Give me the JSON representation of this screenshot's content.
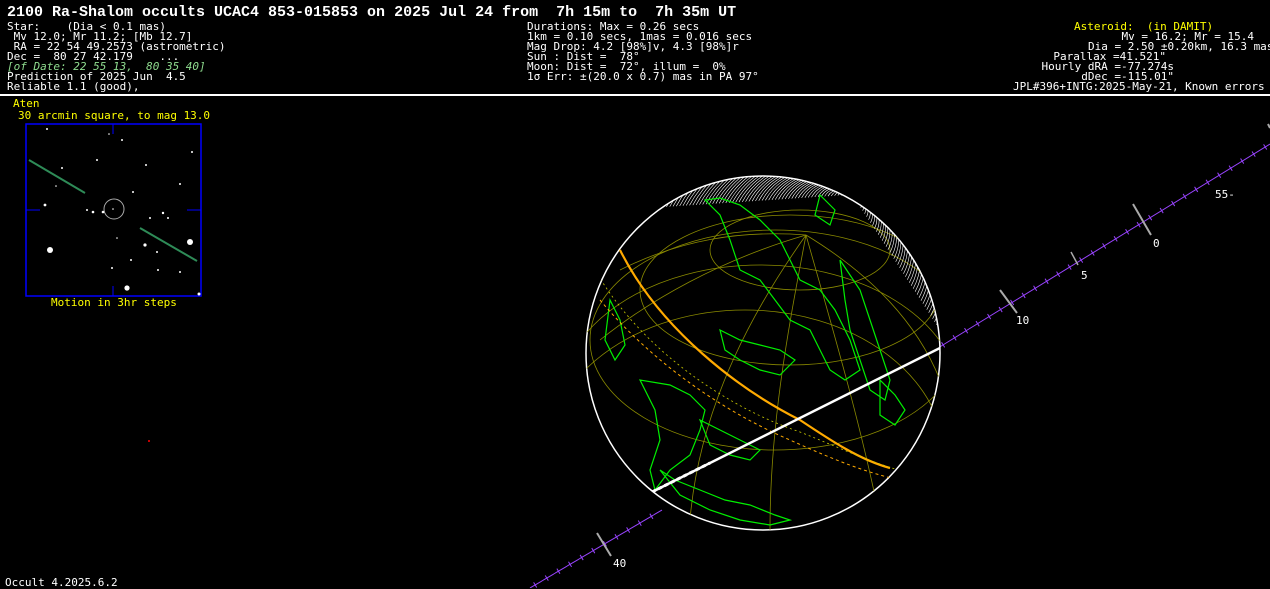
{
  "title": "2100 Ra-Shalom occults UCAC4 853-015853 on 2025 Jul 24 from  7h 15m to  7h 35m UT",
  "star": {
    "lines": [
      "Star:    (Dia < 0.1 mas)",
      " Mv 12.0; Mr 11.2; [Mb 12.7]",
      " RA = 22 54 49.2573 (astrometric)",
      "Dec =  80 27 42.179    ...",
      "[of Date: 22 55 13,  80 35 40]",
      "Prediction of 2025 Jun  4.5",
      "Reliable 1.1 (good),"
    ]
  },
  "event": {
    "lines": [
      "Durations: Max = 0.26 secs",
      "1km = 0.10 secs, 1mas = 0.016 secs",
      "Mag Drop: 4.2 [98%]v, 4.3 [98%]r",
      "Sun : Dist =  78°",
      "Moon: Dist =  72°, illum =  0%",
      "1σ Err: ±(20.0 x 0.7) mas in PA 97°"
    ]
  },
  "asteroid": {
    "header": "Asteroid:  (in DAMIT)",
    "lines": [
      "Mv = 16.2; Mr = 15.4",
      "Dia = 2.50 ±0.20km, 16.3 mas",
      "Parallax =41.521\"",
      "Hourly dRA =-77.274s",
      "dDec =-115.01\"",
      "JPL#396+INTG:2025-May-21, Known errors"
    ]
  },
  "finder": {
    "class_label": "Aten",
    "field_label": "30 arcmin square, to mag 13.0",
    "motion_label": "Motion in 3hr steps"
  },
  "path_ticks": [
    "55-",
    "0",
    "5",
    "10",
    "40"
  ],
  "footer": "Occult 4.2025.6.2",
  "colors": {
    "background": "#000000",
    "text": "#ffffff",
    "highlight": "#ffff00",
    "coastline": "#00ff00",
    "graticule": "#a8a800",
    "path_limit": "#ffaa00",
    "track": "#aa44ff",
    "frame": "#0000ff"
  }
}
